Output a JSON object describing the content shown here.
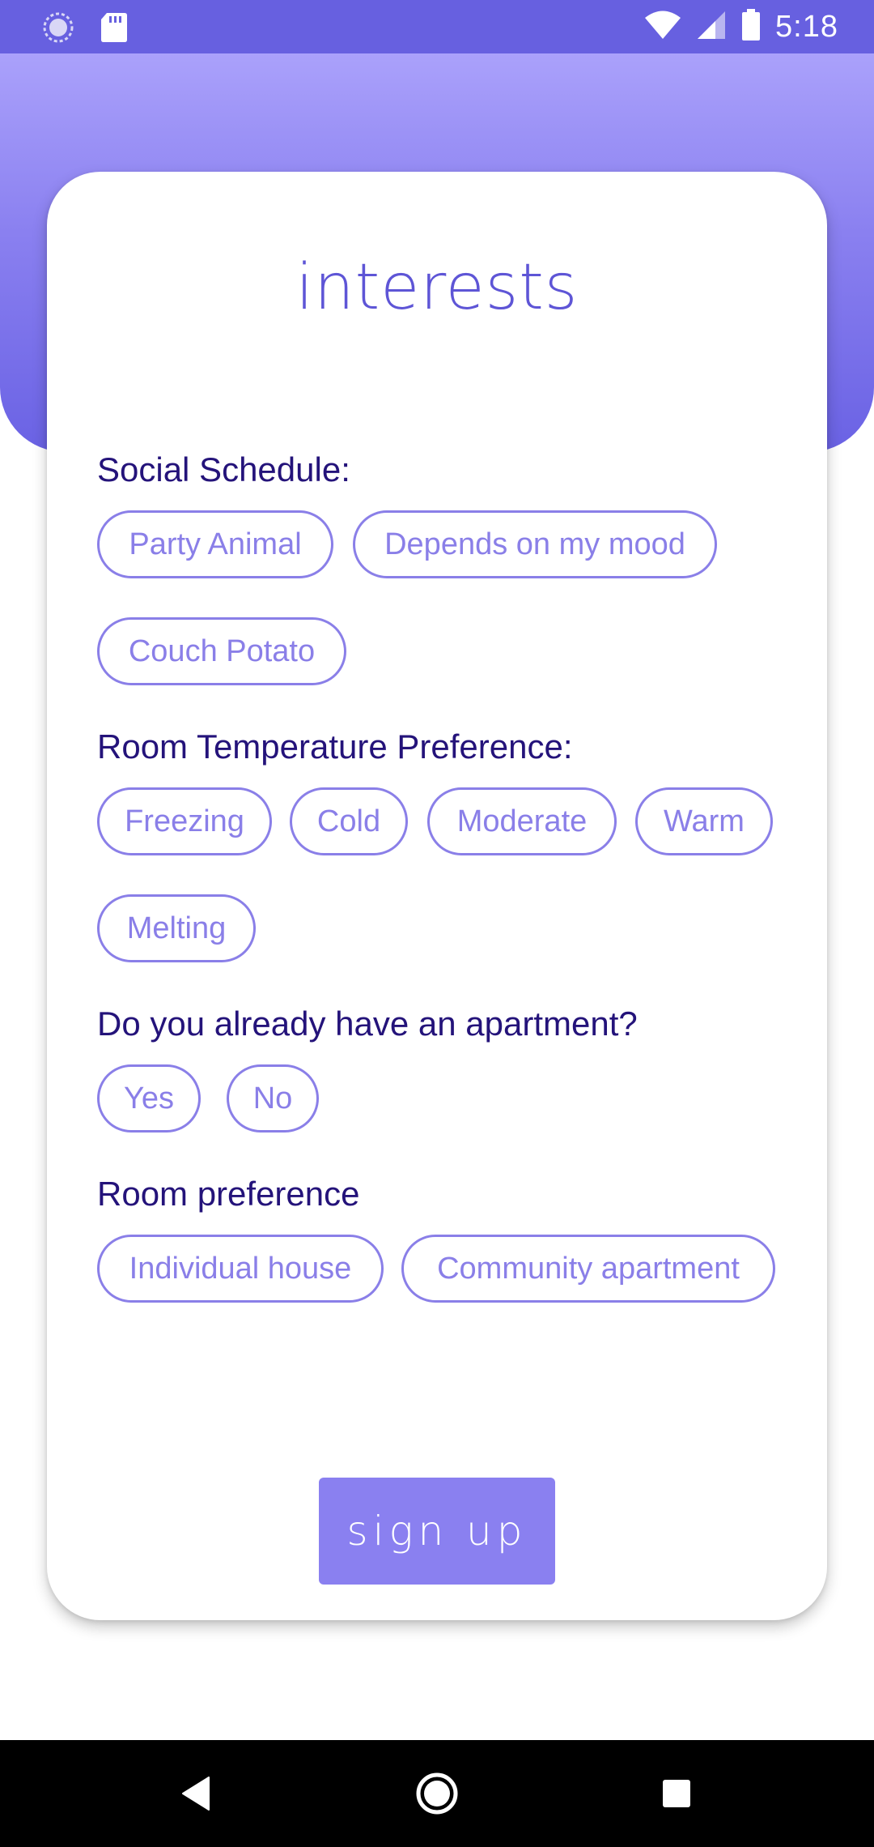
{
  "status_bar": {
    "time": "5:18",
    "left_icons": [
      "loading-icon",
      "sd-card-icon"
    ],
    "right_icons": [
      "wifi-icon",
      "cell-signal-icon",
      "battery-icon"
    ],
    "color": "#6760e0"
  },
  "header": {
    "title": "interests"
  },
  "sections": [
    {
      "label": "Social Schedule:",
      "options": [
        "Party Animal",
        "Depends on my mood",
        "Couch Potato"
      ]
    },
    {
      "label": "Room Temperature Preference:",
      "options": [
        "Freezing",
        "Cold",
        "Moderate",
        "Warm",
        "Melting"
      ]
    },
    {
      "label": "Do you already have an apartment?",
      "options": [
        "Yes",
        "No"
      ]
    },
    {
      "label": "Room preference",
      "options": [
        "Individual house",
        "Community apartment"
      ]
    }
  ],
  "signup_button": {
    "label": "sign up"
  },
  "nav_bar": {
    "items": [
      "back-icon",
      "home-icon",
      "recents-icon"
    ]
  },
  "colors": {
    "accent": "#8a7fe8",
    "label_text": "#24137a",
    "title_text": "#5e55d6",
    "button_bg": "#8a80f0"
  }
}
